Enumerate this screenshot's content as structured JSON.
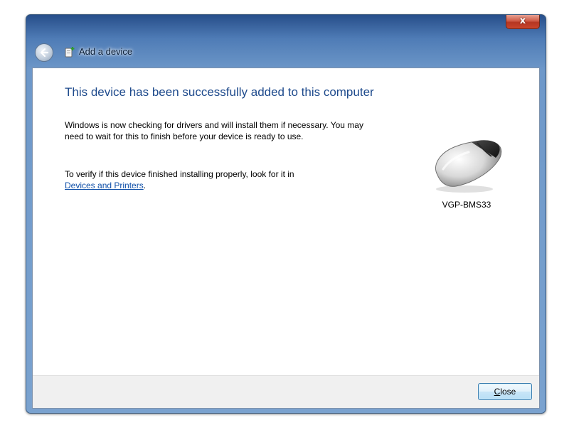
{
  "window": {
    "title": "Add a device",
    "close_glyph": "x"
  },
  "content": {
    "heading": "This device has been successfully added to this computer",
    "para1": "Windows is now checking for drivers and will install them if necessary. You may need to wait for this to finish before your device is ready to use.",
    "para2_prefix": "To verify if this device finished installing properly, look for it in",
    "link_text": "Devices and Printers",
    "para2_suffix": "."
  },
  "device": {
    "name": "VGP-BMS33",
    "icon": "mouse-icon"
  },
  "footer": {
    "close_button": {
      "mnemonic": "C",
      "rest": "lose"
    }
  },
  "colors": {
    "heading": "#1e4a8c",
    "link": "#0f4fa8",
    "title_bar": "#4f7cb6",
    "close_red": "#c9442c"
  }
}
